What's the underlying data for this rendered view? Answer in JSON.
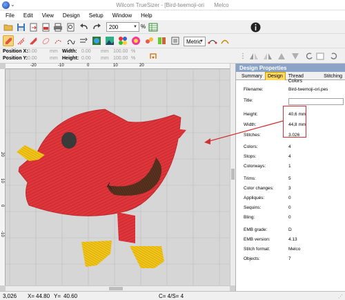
{
  "window": {
    "title": "Wilcom TrueSizer - [Bird-twemoji-ori",
    "title_suffix": "Melco"
  },
  "menu": [
    "File",
    "Edit",
    "View",
    "Design",
    "Setup",
    "Window",
    "Help"
  ],
  "toolbar": {
    "zoom_value": "200",
    "zoom_unit": "%",
    "units_value": "Metric"
  },
  "position": {
    "pos_x_label": "Position X:",
    "pos_y_label": "Position Y:",
    "pos_x_value": "0.00",
    "pos_y_value": "0.00",
    "pos_unit": "mm",
    "width_label": "Width:",
    "height_label": "Height:",
    "width_value": "0.00",
    "height_value": "0.00",
    "size_unit": "mm",
    "width_pct": "100.00",
    "height_pct": "100.00",
    "pct_unit": "%"
  },
  "rulers": {
    "h_ticks": [
      "-20",
      "-10",
      "0",
      "10",
      "20"
    ],
    "v_ticks": [
      "20",
      "10",
      "0",
      "-10"
    ]
  },
  "panel": {
    "title": "Design Properties",
    "tabs": [
      "Summary",
      "Design",
      "Thread Colors",
      "Stitching"
    ],
    "active_tab": "Design"
  },
  "properties": [
    {
      "label": "Filename:",
      "value": "Bird-twemoji-ori.pes"
    },
    {
      "label": "Title:",
      "value": ""
    },
    {
      "label": "Height:",
      "value": "40,6 mm"
    },
    {
      "label": "Width:",
      "value": "44,8 mm"
    },
    {
      "label": "Stitches:",
      "value": "3.026"
    },
    {
      "label": "Colors:",
      "value": "4"
    },
    {
      "label": "Stops:",
      "value": "4"
    },
    {
      "label": "Colorways:",
      "value": "1"
    },
    {
      "label": "Trims:",
      "value": "5"
    },
    {
      "label": "Color changes:",
      "value": "3"
    },
    {
      "label": "Appliqués:",
      "value": "0"
    },
    {
      "label": "Sequins:",
      "value": "0"
    },
    {
      "label": "Bling:",
      "value": "0"
    },
    {
      "label": "EMB grade:",
      "value": "D"
    },
    {
      "label": "EMB version:",
      "value": "4.13"
    },
    {
      "label": "Stitch format:",
      "value": "Melco"
    },
    {
      "label": "Objects:",
      "value": "7"
    }
  ],
  "status": {
    "stitches": "3,026",
    "x_label": "X=",
    "x_value": "44.80",
    "y_label": "Y=",
    "y_value": "40.60",
    "c_text": "C=  4/S=  4"
  },
  "colors": {
    "bird_body": "#e0353b",
    "bird_wing": "#5a3320",
    "bird_eye": "#3a3a3a",
    "bird_beak_feet": "#f2c61a",
    "annotation_red": "#d03030",
    "panel_header": "#8ba3c7",
    "active_tab": "#ffd866"
  }
}
